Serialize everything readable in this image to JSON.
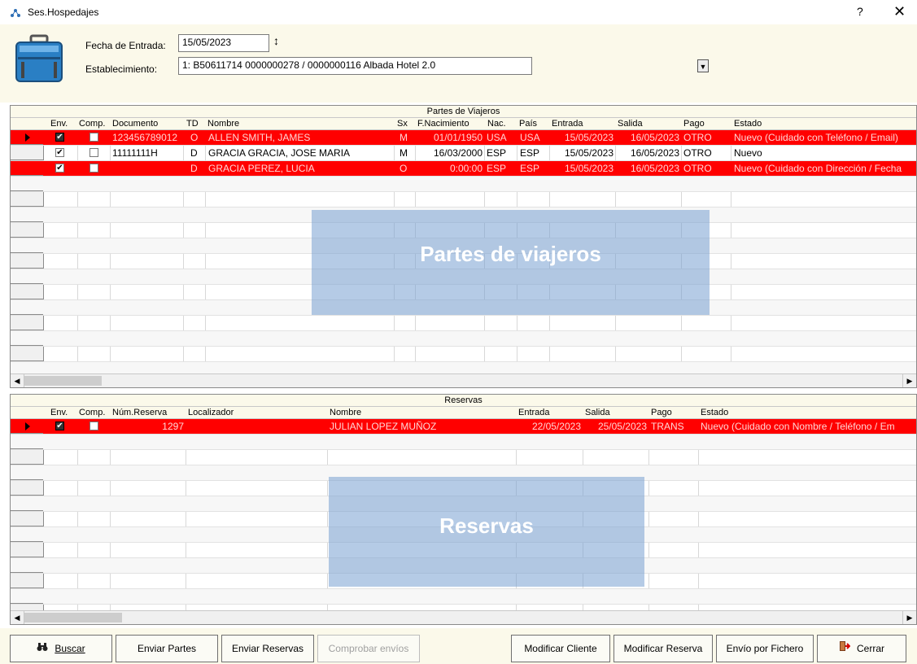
{
  "window": {
    "title": "Ses.Hospedajes",
    "help_label": "?",
    "close_label": "✕"
  },
  "form": {
    "fecha_label": "Fecha de Entrada:",
    "fecha_value": "15/05/2023",
    "estab_label": "Establecimiento:",
    "estab_value": "1: B50611714  0000000278 / 0000000116 Albada Hotel 2.0"
  },
  "partes": {
    "title": "Partes de Viajeros",
    "columns": [
      "Env.",
      "Comp.",
      "Documento",
      "TD",
      "Nombre",
      "Sx",
      "F.Nacimiento",
      "Nac.",
      "País",
      "Entrada",
      "Salida",
      "Pago",
      "Estado"
    ],
    "rows": [
      {
        "env": true,
        "comp": false,
        "documento": "123456789012",
        "td": "O",
        "nombre": "ALLEN SMITH, JAMES",
        "sx": "M",
        "nacimiento": "01/01/1950",
        "nac": "USA",
        "pais": "USA",
        "entrada": "15/05/2023",
        "salida": "16/05/2023",
        "pago": "OTRO",
        "estado": "Nuevo (Cuidado con Teléfono / Email)",
        "highlight": true
      },
      {
        "env": true,
        "comp": false,
        "documento": "11111111H",
        "td": "D",
        "nombre": "GRACIA GRACIA, JOSE MARIA",
        "sx": "M",
        "nacimiento": "16/03/2000",
        "nac": "ESP",
        "pais": "ESP",
        "entrada": "15/05/2023",
        "salida": "16/05/2023",
        "pago": "OTRO",
        "estado": "Nuevo",
        "highlight": false
      },
      {
        "env": true,
        "comp": false,
        "documento": "",
        "td": "D",
        "nombre": "GRACIA PEREZ, LUCIA",
        "sx": "O",
        "nacimiento": "0:00:00",
        "nac": "ESP",
        "pais": "ESP",
        "entrada": "15/05/2023",
        "salida": "16/05/2023",
        "pago": "OTRO",
        "estado": "Nuevo (Cuidado con Dirección / Fecha",
        "highlight": true
      }
    ],
    "overlay_label": "Partes de viajeros"
  },
  "reservas": {
    "title": "Reservas",
    "columns": [
      "Env.",
      "Comp.",
      "Núm.Reserva",
      "Localizador",
      "Nombre",
      "Entrada",
      "Salida",
      "Pago",
      "Estado"
    ],
    "rows": [
      {
        "env": true,
        "comp": false,
        "numero": "1297",
        "localizador": "",
        "nombre": "JULIAN LOPEZ MUÑOZ",
        "entrada": "22/05/2023",
        "salida": "25/05/2023",
        "pago": "TRANS",
        "estado": "Nuevo (Cuidado con Nombre / Teléfono / Em",
        "highlight": true
      }
    ],
    "overlay_label": "Reservas"
  },
  "buttons": {
    "buscar": "Buscar",
    "enviar_partes": "Enviar Partes",
    "enviar_reservas": "Enviar Reservas",
    "comprobar": "Comprobar envíos",
    "modificar_cliente": "Modificar Cliente",
    "modificar_reserva": "Modificar Reserva",
    "envio_fichero": "Envío por Fichero",
    "cerrar": "Cerrar"
  },
  "icons": {
    "app": "hospedajes-icon",
    "suitcase": "suitcase-icon",
    "buscar": "binoculars-icon",
    "cerrar": "exit-door-icon"
  },
  "colors": {
    "highlight_row": "#ff0000",
    "header_bg": "#fbf9ea",
    "overlay": "#78a0d2"
  }
}
